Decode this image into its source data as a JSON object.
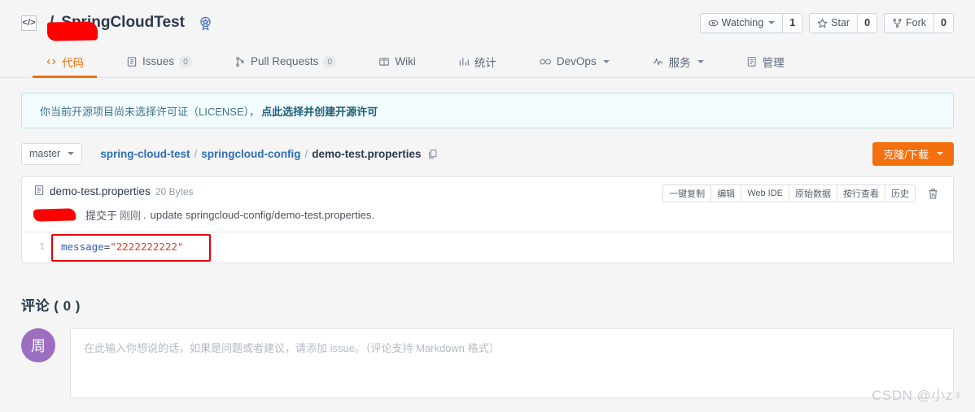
{
  "header": {
    "repo_icon": "code-brackets-icon",
    "owner_redacted": "",
    "separator": "/",
    "repo_name": "SpringCloudTest",
    "badge_icon": "star-badge-icon",
    "watching_label": "Watching",
    "watching_count": "1",
    "star_label": "Star",
    "star_count": "0",
    "fork_label": "Fork",
    "fork_count": "0"
  },
  "nav": {
    "tabs": [
      {
        "label": "代码",
        "icon": "code-icon",
        "count": null,
        "active": true,
        "dropdown": false
      },
      {
        "label": "Issues",
        "icon": "issue-icon",
        "count": "0",
        "active": false,
        "dropdown": false
      },
      {
        "label": "Pull Requests",
        "icon": "pull-request-icon",
        "count": "0",
        "active": false,
        "dropdown": false
      },
      {
        "label": "Wiki",
        "icon": "book-icon",
        "count": null,
        "active": false,
        "dropdown": false
      },
      {
        "label": "统计",
        "icon": "chart-icon",
        "count": null,
        "active": false,
        "dropdown": false
      },
      {
        "label": "DevOps",
        "icon": "infinity-icon",
        "count": null,
        "active": false,
        "dropdown": true
      },
      {
        "label": "服务",
        "icon": "pulse-icon",
        "count": null,
        "active": false,
        "dropdown": true
      },
      {
        "label": "管理",
        "icon": "settings-icon",
        "count": null,
        "active": false,
        "dropdown": false
      }
    ]
  },
  "license_notice": {
    "text": "你当前开源项目尚未选择许可证（LICENSE），",
    "link_text": "点此选择并创建开源许可",
    "accent": "#f2fbfd"
  },
  "path_bar": {
    "branch": "master",
    "crumb_repo": "spring-cloud-test",
    "crumb_dir": "springcloud-config",
    "crumb_file": "demo-test.properties",
    "separator": "/",
    "copy_icon": "copy-icon",
    "clone_label": "克隆/下载",
    "clone_color": "#f2700d"
  },
  "file": {
    "name": "demo-test.properties",
    "size": "20 Bytes",
    "file_icon": "file-text-icon",
    "actions": [
      "一键复制",
      "编辑",
      "Web IDE",
      "原始数据",
      "按行查看",
      "历史"
    ],
    "delete_icon": "trash-icon",
    "commit_author_redacted": "",
    "commit_verb": "提交于",
    "commit_time": "刚刚",
    "commit_dot": ".",
    "commit_message": "update springcloud-config/demo-test.properties.",
    "code": {
      "line_number": "1",
      "key": "message",
      "operator": "=",
      "value": "\"2222222222\"",
      "highlight_color": "#e60000"
    }
  },
  "comments": {
    "title": "评论 ( 0 )",
    "avatar_initial": "周",
    "avatar_color": "#9b6ec0",
    "placeholder": "在此输入你想说的话，如果是问题或者建议，请添加 issue。（评论支持 Markdown 格式）"
  },
  "watermark": "CSDN @小z♀"
}
